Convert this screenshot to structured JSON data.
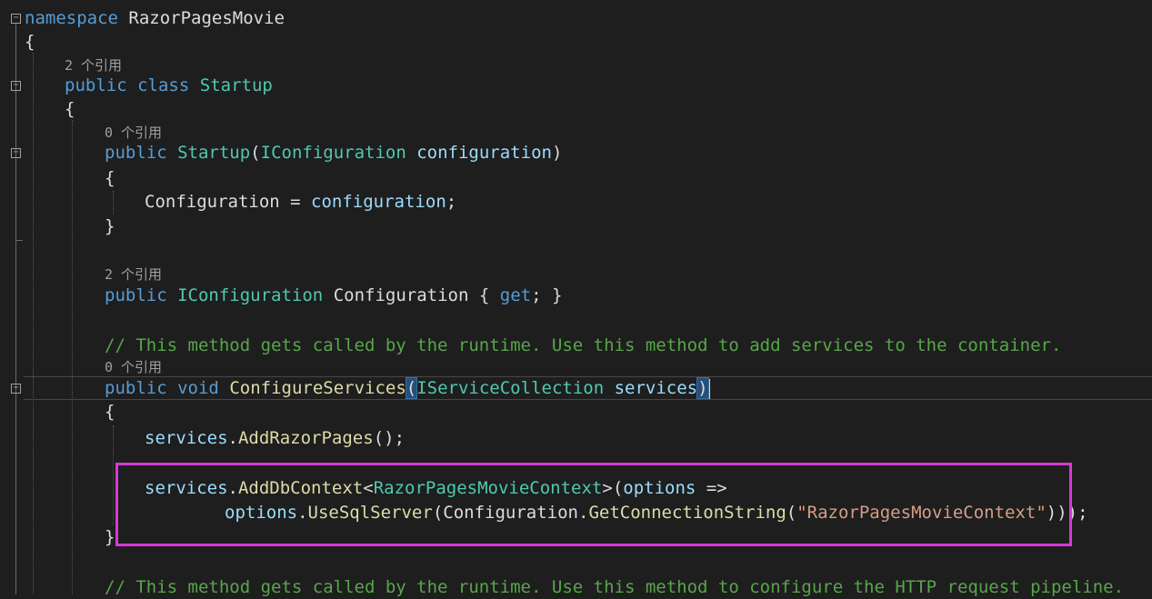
{
  "code": {
    "ns_kw": "namespace",
    "ns_name": "RazorPagesMovie",
    "open_brace": "{",
    "close_brace": "}",
    "refs_2": "2 个引用",
    "refs_0": "0 个引用",
    "kw_public": "public",
    "kw_class": "class",
    "class_name": "Startup",
    "ctor_name": "Startup",
    "iconfiguration": "IConfiguration",
    "param_configuration": "configuration",
    "prop_configuration": "Configuration",
    "assign": " = ",
    "semicolon": ";",
    "kw_get": "get",
    "comment_add_services": "// This method gets called by the runtime. Use this method to add services to the container.",
    "kw_void": "void",
    "configure_services": "ConfigureServices",
    "iservicecollection": "IServiceCollection",
    "param_services": "services",
    "add_razor_pages": "AddRazorPages",
    "add_db_context": "AddDbContext",
    "context_type": "RazorPagesMovieContext",
    "param_options": "options",
    "arrow": " =>",
    "use_sql_server": "UseSqlServer",
    "get_connection_string": "GetConnectionString",
    "connection_name": "\"RazorPagesMovieContext\"",
    "comment_configure": "// This method gets called by the runtime. Use this method to configure the HTTP request pipeline."
  },
  "colors": {
    "background": "#1e1e1e",
    "keyword": "#569cd6",
    "type": "#4ec9b0",
    "method": "#dcdcaa",
    "parameter": "#9cdcfe",
    "comment": "#57a64a",
    "string": "#d69d85",
    "highlight_box": "#d63ad6"
  }
}
